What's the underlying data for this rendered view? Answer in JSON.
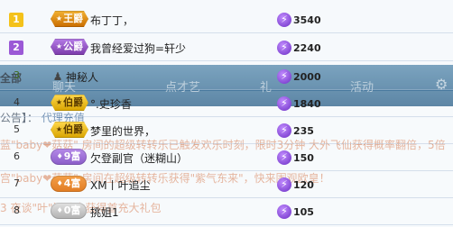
{
  "colors": {
    "rank1": "#f4c21a",
    "rank2": "#9b59d6",
    "rank3": "#7bc86b",
    "king": "#c96c00",
    "duke": "#7a3aa9",
    "earl": "#d8a400",
    "viscount": "#9a6cd4",
    "baron": "#e27c22",
    "knight": "#c2c2c2"
  },
  "background": {
    "tabs": [
      "聊天",
      "点才艺",
      "礼",
      "活动"
    ],
    "active_tab": "全部",
    "corner_icon": "car-icon",
    "notice_label": "公告】：",
    "notice_link": "代理充值",
    "chat_lines": [
      "蓝\"baby❤菇菇\" 房间的超级转转乐已触发欢乐时刻，限时3分钟 大外飞仙获得概率翻倍，5倍",
      "宫\"baby❤菇菇\" 房间在超级转转乐获得\"紫气东来\"，快来围观欧皇！",
      "3 夜谈\"叶\"活动中获得首充大礼包"
    ]
  },
  "rows": [
    {
      "rank": "1",
      "badge": "王爵",
      "badge_style": "king",
      "name": "布丁丁，",
      "score": "3540"
    },
    {
      "rank": "2",
      "badge": "公爵",
      "badge_style": "duke",
      "name": "我曾经爱过狗=轩少",
      "score": "2240"
    },
    {
      "rank": "3",
      "badge": "",
      "badge_style": "none",
      "name": "神秘人",
      "score": "2000",
      "icon": "mystery-person-icon"
    },
    {
      "rank": "4",
      "badge": "伯爵",
      "badge_style": "earl",
      "name": "°.史珍香",
      "score": "1840"
    },
    {
      "rank": "5",
      "badge": "伯爵",
      "badge_style": "earl",
      "name": "梦里的世界，",
      "score": "235"
    },
    {
      "rank": "6",
      "badge": "9富",
      "badge_style": "viscount",
      "name": "欠登副官（迷糊山）",
      "score": "150"
    },
    {
      "rank": "7",
      "badge": "4富",
      "badge_style": "baron",
      "name": "XM丨叶追尘",
      "score": "120"
    },
    {
      "rank": "8",
      "badge": "0富",
      "badge_style": "knight",
      "name": "挑姐1",
      "score": "105"
    }
  ]
}
